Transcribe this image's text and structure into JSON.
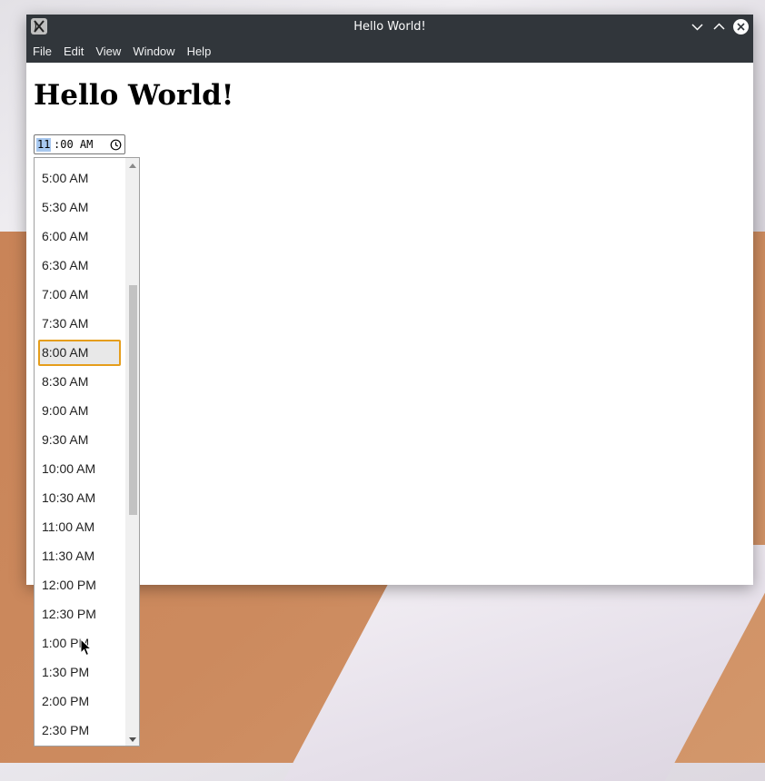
{
  "window": {
    "title": "Hello World!"
  },
  "menubar": {
    "items": [
      "File",
      "Edit",
      "View",
      "Window",
      "Help"
    ]
  },
  "page": {
    "heading": "Hello World!"
  },
  "time_input": {
    "hour": "11",
    "rest": ":00 AM"
  },
  "dropdown": {
    "selected": "8:00 AM",
    "options": [
      "5:00 AM",
      "5:30 AM",
      "6:00 AM",
      "6:30 AM",
      "7:00 AM",
      "7:30 AM",
      "8:00 AM",
      "8:30 AM",
      "9:00 AM",
      "9:30 AM",
      "10:00 AM",
      "10:30 AM",
      "11:00 AM",
      "11:30 AM",
      "12:00 PM",
      "12:30 PM",
      "1:00 PM",
      "1:30 PM",
      "2:00 PM",
      "2:30 PM"
    ]
  },
  "icons": {
    "app": "app-x-icon",
    "minimize": "chevron-down-icon",
    "maximize": "chevron-up-icon",
    "close": "close-icon",
    "clock": "clock-icon",
    "cursor": "mouse-pointer-icon"
  },
  "colors": {
    "titlebar": "#31363b",
    "selection_border": "#e59d1b",
    "hour_highlight": "#a8c8ef"
  }
}
